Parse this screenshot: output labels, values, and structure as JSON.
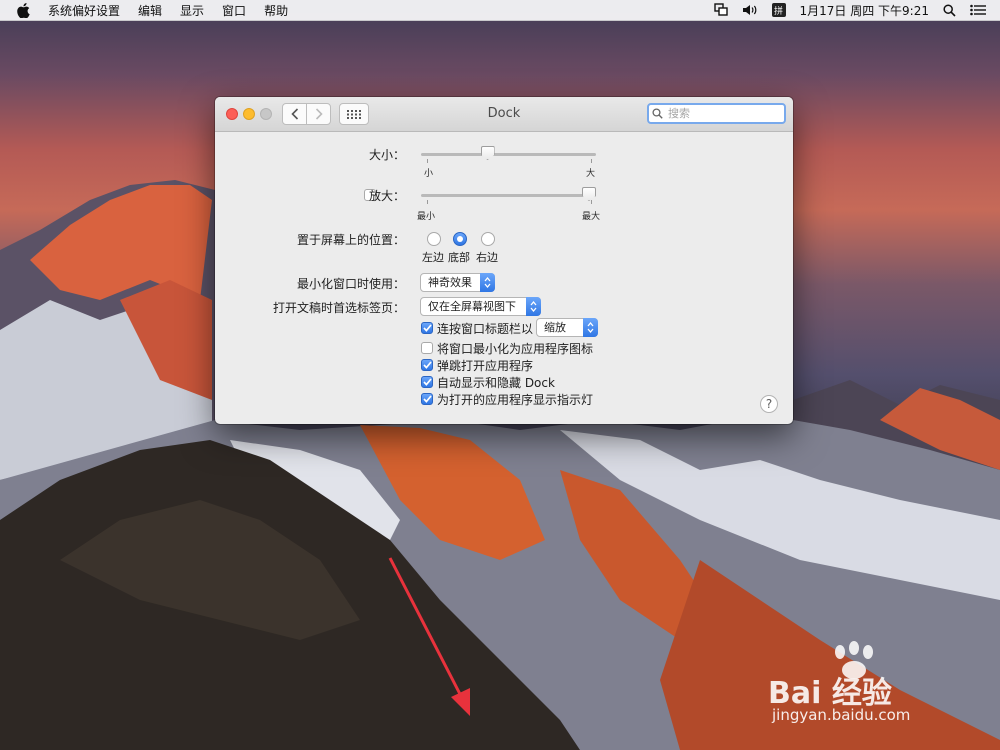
{
  "menubar": {
    "app_name": "系统偏好设置",
    "items": [
      "编辑",
      "显示",
      "窗口",
      "帮助"
    ],
    "ime": "拼",
    "datetime": "1月17日 周四 下午9:21"
  },
  "window": {
    "title": "Dock",
    "search_placeholder": "搜索",
    "size": {
      "label": "大小：",
      "min_label": "小",
      "max_label": "大",
      "value": 0.37
    },
    "magnification": {
      "label": "放大：",
      "checked": false,
      "min_label": "最小",
      "max_label": "最大",
      "value": 1.0
    },
    "position": {
      "label": "置于屏幕上的位置：",
      "options": [
        "左边",
        "底部",
        "右边"
      ],
      "selected": "底部"
    },
    "minimize_effect": {
      "label": "最小化窗口时使用：",
      "value": "神奇效果"
    },
    "prefer_tabs": {
      "label": "打开文稿时首选标签页：",
      "value": "仅在全屏幕视图下"
    },
    "double_click": {
      "label": "连按窗口标题栏以",
      "checked": true,
      "value": "缩放"
    },
    "checkboxes": [
      {
        "label": "将窗口最小化为应用程序图标",
        "checked": false
      },
      {
        "label": "弹跳打开应用程序",
        "checked": true
      },
      {
        "label": "自动显示和隐藏 Dock",
        "checked": true
      },
      {
        "label": "为打开的应用程序显示指示灯",
        "checked": true
      }
    ],
    "help": "?"
  },
  "watermark": {
    "logo": "Bai 经验",
    "url": "jingyan.baidu.com"
  },
  "colors": {
    "accent": "#2f76e4",
    "annotation_arrow": "#e8323c"
  }
}
